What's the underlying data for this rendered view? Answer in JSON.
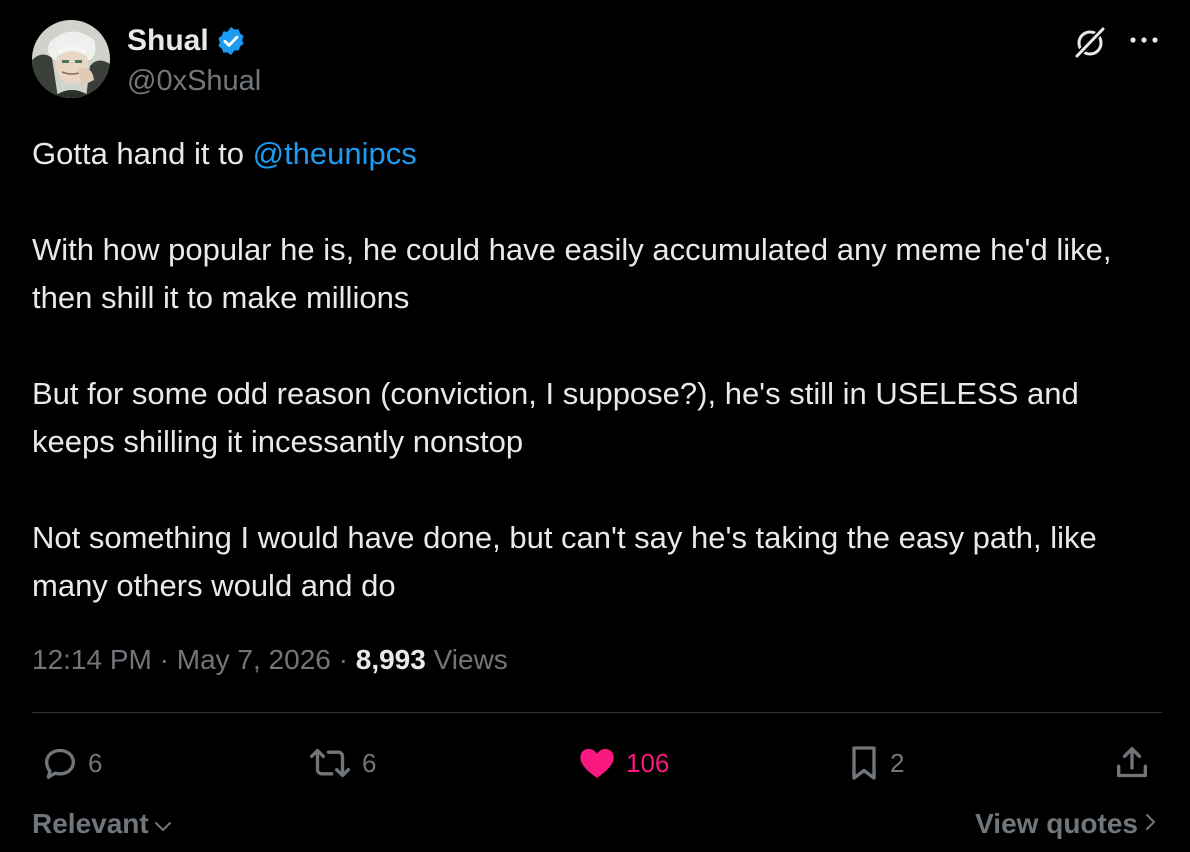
{
  "author": {
    "name": "Shual",
    "handle": "@0xShual",
    "verified": true,
    "verified_color": "#1d9bf0"
  },
  "header_icons": [
    "grok-icon",
    "more-icon"
  ],
  "tweet": {
    "line1_prefix": "Gotta hand it to ",
    "mention": "@theunipcs",
    "paragraph2": "With how popular he is, he could have easily accumulated any meme he'd like, then shill it to make millions",
    "paragraph3": "But for some odd reason (conviction, I suppose?), he's still in USELESS and keeps shilling it incessantly nonstop",
    "paragraph4": "Not something I would have done, but can't say he's taking the easy path, like many others would and do"
  },
  "meta": {
    "time": "12:14 PM",
    "separator": " · ",
    "date": "May 7, 2026",
    "views_count": "8,993",
    "views_label": " Views"
  },
  "actions": {
    "replies": "6",
    "reposts": "6",
    "likes": "106",
    "bookmarks": "2"
  },
  "footer": {
    "sort_label": "Relevant",
    "view_quotes_label": "View quotes"
  },
  "colors": {
    "background": "#000000",
    "text": "#e7e9ea",
    "muted": "#71767b",
    "link": "#1d9bf0",
    "like": "#f91880",
    "divider": "#2f3336"
  }
}
